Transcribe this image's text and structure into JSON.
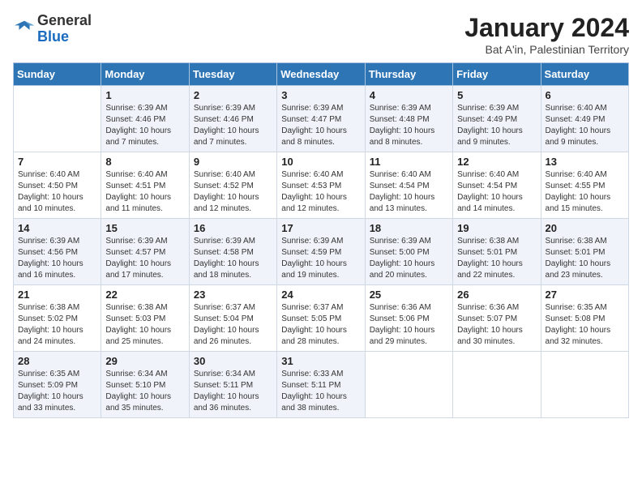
{
  "header": {
    "logo_general": "General",
    "logo_blue": "Blue",
    "month_year": "January 2024",
    "location": "Bat A'in, Palestinian Territory"
  },
  "weekdays": [
    "Sunday",
    "Monday",
    "Tuesday",
    "Wednesday",
    "Thursday",
    "Friday",
    "Saturday"
  ],
  "weeks": [
    [
      {
        "day": "",
        "sunrise": "",
        "sunset": "",
        "daylight": ""
      },
      {
        "day": "1",
        "sunrise": "Sunrise: 6:39 AM",
        "sunset": "Sunset: 4:46 PM",
        "daylight": "Daylight: 10 hours and 7 minutes."
      },
      {
        "day": "2",
        "sunrise": "Sunrise: 6:39 AM",
        "sunset": "Sunset: 4:46 PM",
        "daylight": "Daylight: 10 hours and 7 minutes."
      },
      {
        "day": "3",
        "sunrise": "Sunrise: 6:39 AM",
        "sunset": "Sunset: 4:47 PM",
        "daylight": "Daylight: 10 hours and 8 minutes."
      },
      {
        "day": "4",
        "sunrise": "Sunrise: 6:39 AM",
        "sunset": "Sunset: 4:48 PM",
        "daylight": "Daylight: 10 hours and 8 minutes."
      },
      {
        "day": "5",
        "sunrise": "Sunrise: 6:39 AM",
        "sunset": "Sunset: 4:49 PM",
        "daylight": "Daylight: 10 hours and 9 minutes."
      },
      {
        "day": "6",
        "sunrise": "Sunrise: 6:40 AM",
        "sunset": "Sunset: 4:49 PM",
        "daylight": "Daylight: 10 hours and 9 minutes."
      }
    ],
    [
      {
        "day": "7",
        "sunrise": "Sunrise: 6:40 AM",
        "sunset": "Sunset: 4:50 PM",
        "daylight": "Daylight: 10 hours and 10 minutes."
      },
      {
        "day": "8",
        "sunrise": "Sunrise: 6:40 AM",
        "sunset": "Sunset: 4:51 PM",
        "daylight": "Daylight: 10 hours and 11 minutes."
      },
      {
        "day": "9",
        "sunrise": "Sunrise: 6:40 AM",
        "sunset": "Sunset: 4:52 PM",
        "daylight": "Daylight: 10 hours and 12 minutes."
      },
      {
        "day": "10",
        "sunrise": "Sunrise: 6:40 AM",
        "sunset": "Sunset: 4:53 PM",
        "daylight": "Daylight: 10 hours and 12 minutes."
      },
      {
        "day": "11",
        "sunrise": "Sunrise: 6:40 AM",
        "sunset": "Sunset: 4:54 PM",
        "daylight": "Daylight: 10 hours and 13 minutes."
      },
      {
        "day": "12",
        "sunrise": "Sunrise: 6:40 AM",
        "sunset": "Sunset: 4:54 PM",
        "daylight": "Daylight: 10 hours and 14 minutes."
      },
      {
        "day": "13",
        "sunrise": "Sunrise: 6:40 AM",
        "sunset": "Sunset: 4:55 PM",
        "daylight": "Daylight: 10 hours and 15 minutes."
      }
    ],
    [
      {
        "day": "14",
        "sunrise": "Sunrise: 6:39 AM",
        "sunset": "Sunset: 4:56 PM",
        "daylight": "Daylight: 10 hours and 16 minutes."
      },
      {
        "day": "15",
        "sunrise": "Sunrise: 6:39 AM",
        "sunset": "Sunset: 4:57 PM",
        "daylight": "Daylight: 10 hours and 17 minutes."
      },
      {
        "day": "16",
        "sunrise": "Sunrise: 6:39 AM",
        "sunset": "Sunset: 4:58 PM",
        "daylight": "Daylight: 10 hours and 18 minutes."
      },
      {
        "day": "17",
        "sunrise": "Sunrise: 6:39 AM",
        "sunset": "Sunset: 4:59 PM",
        "daylight": "Daylight: 10 hours and 19 minutes."
      },
      {
        "day": "18",
        "sunrise": "Sunrise: 6:39 AM",
        "sunset": "Sunset: 5:00 PM",
        "daylight": "Daylight: 10 hours and 20 minutes."
      },
      {
        "day": "19",
        "sunrise": "Sunrise: 6:38 AM",
        "sunset": "Sunset: 5:01 PM",
        "daylight": "Daylight: 10 hours and 22 minutes."
      },
      {
        "day": "20",
        "sunrise": "Sunrise: 6:38 AM",
        "sunset": "Sunset: 5:01 PM",
        "daylight": "Daylight: 10 hours and 23 minutes."
      }
    ],
    [
      {
        "day": "21",
        "sunrise": "Sunrise: 6:38 AM",
        "sunset": "Sunset: 5:02 PM",
        "daylight": "Daylight: 10 hours and 24 minutes."
      },
      {
        "day": "22",
        "sunrise": "Sunrise: 6:38 AM",
        "sunset": "Sunset: 5:03 PM",
        "daylight": "Daylight: 10 hours and 25 minutes."
      },
      {
        "day": "23",
        "sunrise": "Sunrise: 6:37 AM",
        "sunset": "Sunset: 5:04 PM",
        "daylight": "Daylight: 10 hours and 26 minutes."
      },
      {
        "day": "24",
        "sunrise": "Sunrise: 6:37 AM",
        "sunset": "Sunset: 5:05 PM",
        "daylight": "Daylight: 10 hours and 28 minutes."
      },
      {
        "day": "25",
        "sunrise": "Sunrise: 6:36 AM",
        "sunset": "Sunset: 5:06 PM",
        "daylight": "Daylight: 10 hours and 29 minutes."
      },
      {
        "day": "26",
        "sunrise": "Sunrise: 6:36 AM",
        "sunset": "Sunset: 5:07 PM",
        "daylight": "Daylight: 10 hours and 30 minutes."
      },
      {
        "day": "27",
        "sunrise": "Sunrise: 6:35 AM",
        "sunset": "Sunset: 5:08 PM",
        "daylight": "Daylight: 10 hours and 32 minutes."
      }
    ],
    [
      {
        "day": "28",
        "sunrise": "Sunrise: 6:35 AM",
        "sunset": "Sunset: 5:09 PM",
        "daylight": "Daylight: 10 hours and 33 minutes."
      },
      {
        "day": "29",
        "sunrise": "Sunrise: 6:34 AM",
        "sunset": "Sunset: 5:10 PM",
        "daylight": "Daylight: 10 hours and 35 minutes."
      },
      {
        "day": "30",
        "sunrise": "Sunrise: 6:34 AM",
        "sunset": "Sunset: 5:11 PM",
        "daylight": "Daylight: 10 hours and 36 minutes."
      },
      {
        "day": "31",
        "sunrise": "Sunrise: 6:33 AM",
        "sunset": "Sunset: 5:11 PM",
        "daylight": "Daylight: 10 hours and 38 minutes."
      },
      {
        "day": "",
        "sunrise": "",
        "sunset": "",
        "daylight": ""
      },
      {
        "day": "",
        "sunrise": "",
        "sunset": "",
        "daylight": ""
      },
      {
        "day": "",
        "sunrise": "",
        "sunset": "",
        "daylight": ""
      }
    ]
  ]
}
